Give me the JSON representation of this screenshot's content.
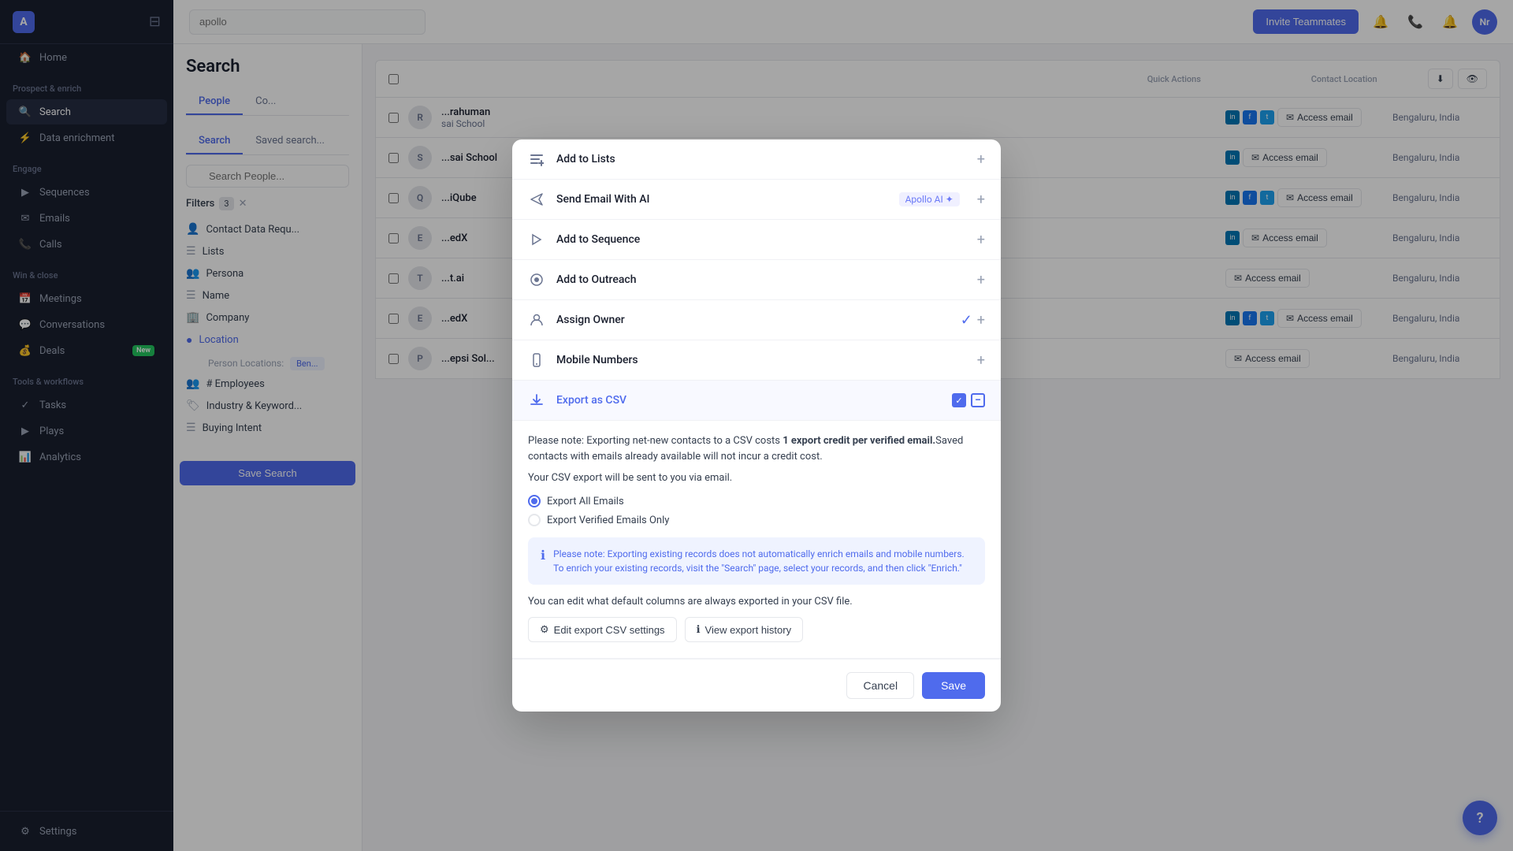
{
  "app": {
    "logo_text": "A",
    "avatar_text": "Nr"
  },
  "topbar": {
    "search_placeholder": "apollo",
    "invite_btn_label": "Invite Teammates"
  },
  "sidebar": {
    "sections": [
      {
        "label": "",
        "items": [
          {
            "id": "home",
            "label": "Home",
            "icon": "🏠"
          }
        ]
      },
      {
        "label": "Prospect & enrich",
        "items": [
          {
            "id": "search",
            "label": "Search",
            "icon": "🔍",
            "active": true
          },
          {
            "id": "data-enrichment",
            "label": "Data enrichment",
            "icon": "⚡"
          }
        ]
      },
      {
        "label": "Engage",
        "items": [
          {
            "id": "sequences",
            "label": "Sequences",
            "icon": "▶"
          },
          {
            "id": "emails",
            "label": "Emails",
            "icon": "✉"
          },
          {
            "id": "calls",
            "label": "Calls",
            "icon": "📞"
          }
        ]
      },
      {
        "label": "Win & close",
        "items": [
          {
            "id": "meetings",
            "label": "Meetings",
            "icon": "📅"
          },
          {
            "id": "conversations",
            "label": "Conversations",
            "icon": "💬"
          },
          {
            "id": "deals",
            "label": "Deals",
            "icon": "💰",
            "badge": "New"
          }
        ]
      },
      {
        "label": "Tools & workflows",
        "items": [
          {
            "id": "tasks",
            "label": "Tasks",
            "icon": "✓"
          },
          {
            "id": "plays",
            "label": "Plays",
            "icon": "▶"
          },
          {
            "id": "analytics",
            "label": "Analytics",
            "icon": "📊"
          }
        ]
      }
    ],
    "bottom": [
      {
        "id": "settings",
        "label": "Settings",
        "icon": "⚙"
      }
    ]
  },
  "main": {
    "page_title": "Search",
    "tabs": [
      {
        "id": "people",
        "label": "People",
        "active": true
      },
      {
        "id": "companies",
        "label": "Co..."
      }
    ],
    "sub_tabs": [
      {
        "id": "search",
        "label": "Search",
        "active": true
      },
      {
        "id": "saved_searches",
        "label": "Saved search..."
      }
    ],
    "filters_label": "Filters",
    "filters_count": "3",
    "search_placeholder": "Search People...",
    "col_headers": {
      "quick_actions": "Quick Actions",
      "contact_location": "Contact Location"
    },
    "filter_items": [
      {
        "label": "Contact Data Requ..."
      },
      {
        "label": "Lists"
      },
      {
        "label": "Persona"
      },
      {
        "label": "Name"
      },
      {
        "label": "Company"
      },
      {
        "label": "Location"
      },
      {
        "label": "# Employees"
      },
      {
        "label": "Industry & Keyword..."
      },
      {
        "label": "Buying Intent"
      }
    ],
    "person_locations_label": "Person Locations:",
    "person_location_tag": "Ben...",
    "contacts": [
      {
        "id": 1,
        "name": "...rahuman",
        "company": "sai School",
        "location": "Bengaluru, India",
        "has_linkedin": true,
        "has_facebook": false,
        "has_twitter": true
      },
      {
        "id": 2,
        "name": "...sai School",
        "company": "",
        "location": "Bengaluru, India",
        "has_linkedin": true,
        "has_facebook": false,
        "has_twitter": false
      },
      {
        "id": 3,
        "name": "...iQube",
        "company": "",
        "location": "Bengaluru, India",
        "has_linkedin": true,
        "has_facebook": true,
        "has_twitter": true
      },
      {
        "id": 4,
        "name": "...edX",
        "company": "",
        "location": "Bengaluru, India",
        "has_linkedin": true,
        "has_facebook": false,
        "has_twitter": false
      },
      {
        "id": 5,
        "name": "...t.ai",
        "company": "",
        "location": "Bengaluru, India",
        "has_linkedin": false,
        "has_facebook": false,
        "has_twitter": false
      },
      {
        "id": 6,
        "name": "...edX",
        "company": "",
        "location": "Bengaluru, India",
        "has_linkedin": true,
        "has_facebook": true,
        "has_twitter": true
      },
      {
        "id": 7,
        "name": "...epsi Sol...",
        "company": "",
        "location": "Bengaluru, India",
        "has_linkedin": false,
        "has_facebook": false,
        "has_twitter": false
      }
    ],
    "access_email_label": "Access email",
    "save_search_label": "Save Search"
  },
  "modal": {
    "items": [
      {
        "id": "add-to-lists",
        "label": "Add to Lists",
        "icon": "≡+",
        "action": "plus"
      },
      {
        "id": "send-email-ai",
        "label": "Send Email With AI",
        "badge": "Apollo AI ✦",
        "icon": "✦",
        "action": "plus"
      },
      {
        "id": "add-to-sequence",
        "label": "Add to Sequence",
        "icon": "▷",
        "action": "plus"
      },
      {
        "id": "add-to-outreach",
        "label": "Add to Outreach",
        "icon": "⊙",
        "action": "plus"
      },
      {
        "id": "assign-owner",
        "label": "Assign Owner",
        "icon": "👤",
        "action": "check-plus"
      },
      {
        "id": "mobile-numbers",
        "label": "Mobile Numbers",
        "icon": "📞",
        "action": "plus"
      },
      {
        "id": "export-csv",
        "label": "Export as CSV",
        "icon": "⬇",
        "action": "check-minus",
        "active": true
      }
    ],
    "export_section": {
      "note": "Please note: Exporting net-new contacts to a CSV costs ",
      "note_bold": "1 export credit per verified email.",
      "note_suffix": "Saved contacts with emails already available will not incur a credit cost.",
      "sent_note": "Your CSV export will be sent to you via email.",
      "radio_options": [
        {
          "id": "all-emails",
          "label": "Export All Emails",
          "checked": true
        },
        {
          "id": "verified-only",
          "label": "Export Verified Emails Only",
          "checked": false
        }
      ],
      "info_text": "Please note: Exporting existing records does not automatically enrich emails and mobile numbers. To enrich your existing records, visit the \"Search\" page, select your records, and then click \"Enrich.\"",
      "columns_note": "You can edit what default columns are always exported in your CSV file.",
      "edit_settings_label": "Edit export CSV settings",
      "view_history_label": "View export history"
    },
    "footer": {
      "cancel_label": "Cancel",
      "save_label": "Save"
    }
  },
  "help_btn": "?"
}
